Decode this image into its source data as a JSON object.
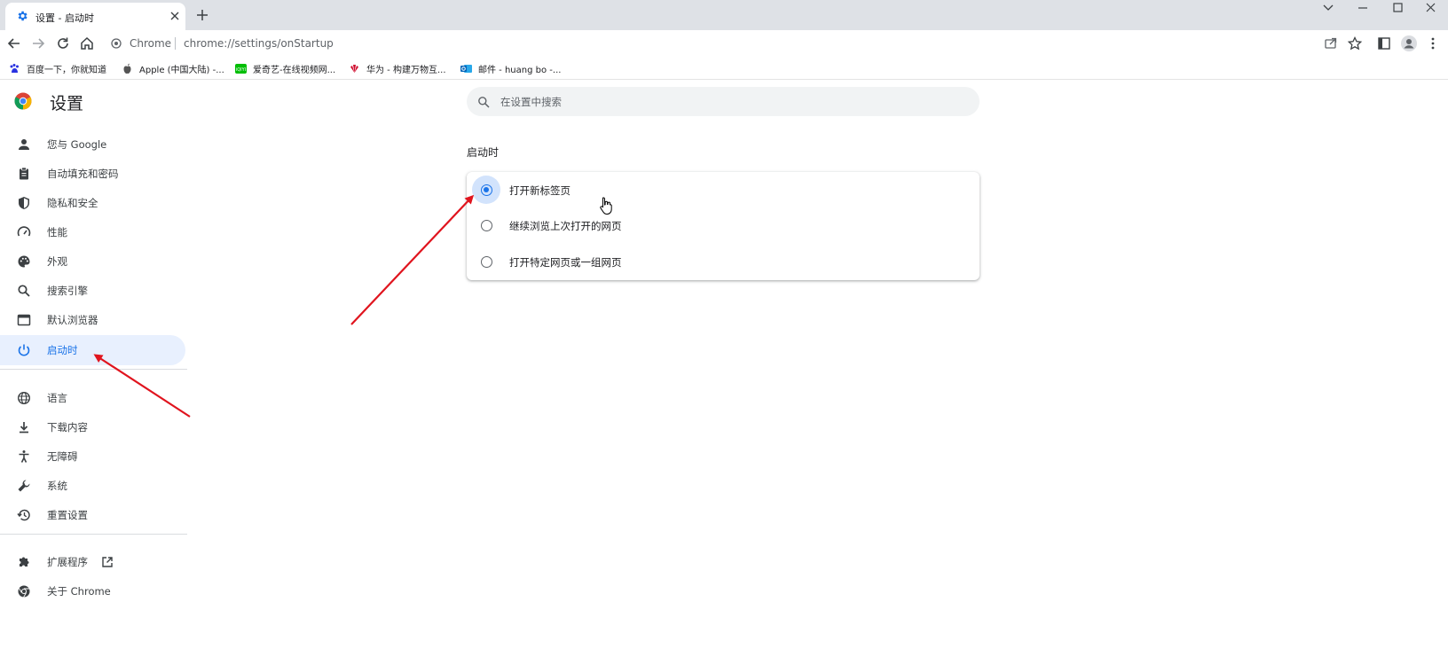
{
  "tab": {
    "title": "设置 - 启动时"
  },
  "omnibox": {
    "chip": "Chrome",
    "url": "chrome://settings/onStartup"
  },
  "bookmarks": [
    {
      "label": "百度一下，你就知道",
      "icon": "baidu-icon"
    },
    {
      "label": "Apple (中国大陆) -...",
      "icon": "apple-icon"
    },
    {
      "label": "爱奇艺-在线视频网...",
      "icon": "iqiyi-icon"
    },
    {
      "label": "华为 - 构建万物互...",
      "icon": "huawei-icon"
    },
    {
      "label": "邮件 - huang bo -...",
      "icon": "outlook-icon"
    }
  ],
  "sidebar": {
    "title": "设置",
    "items": [
      {
        "label": "您与 Google",
        "icon": "person-icon"
      },
      {
        "label": "自动填充和密码",
        "icon": "clipboard-icon"
      },
      {
        "label": "隐私和安全",
        "icon": "shield-icon"
      },
      {
        "label": "性能",
        "icon": "speedometer-icon"
      },
      {
        "label": "外观",
        "icon": "palette-icon"
      },
      {
        "label": "搜索引擎",
        "icon": "search-icon"
      },
      {
        "label": "默认浏览器",
        "icon": "browser-window-icon"
      },
      {
        "label": "启动时",
        "icon": "power-icon",
        "selected": true
      },
      {
        "label": "语言",
        "icon": "globe-icon"
      },
      {
        "label": "下载内容",
        "icon": "download-icon"
      },
      {
        "label": "无障碍",
        "icon": "accessibility-icon"
      },
      {
        "label": "系统",
        "icon": "wrench-icon"
      },
      {
        "label": "重置设置",
        "icon": "history-icon"
      },
      {
        "label": "扩展程序",
        "icon": "puzzle-icon"
      },
      {
        "label": "关于 Chrome",
        "icon": "chrome-icon"
      }
    ]
  },
  "search": {
    "placeholder": "在设置中搜索"
  },
  "startup": {
    "section_title": "启动时",
    "options": [
      {
        "label": "打开新标签页",
        "checked": true
      },
      {
        "label": "继续浏览上次打开的网页",
        "checked": false
      },
      {
        "label": "打开特定网页或一组网页",
        "checked": false
      }
    ]
  },
  "colors": {
    "accent": "#1a73e8",
    "selected_bg": "#e8f0fe",
    "annotation_arrow": "#e0141e"
  }
}
